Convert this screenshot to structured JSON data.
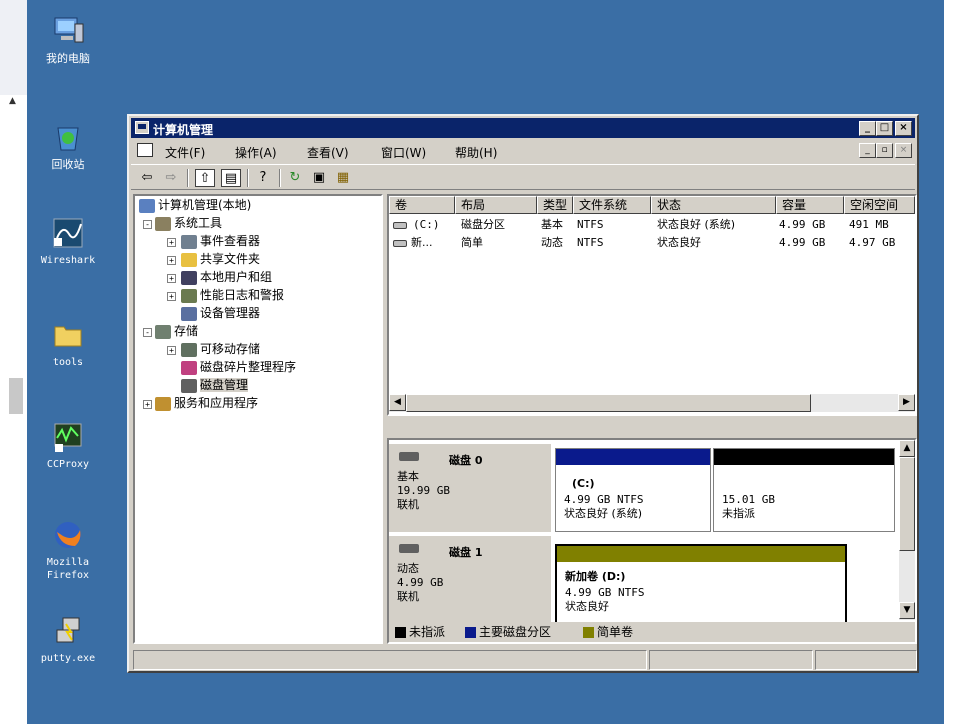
{
  "desktop": {
    "icons": [
      {
        "id": "my-computer",
        "label": "我的电脑",
        "icon": "computer-icon"
      },
      {
        "id": "recycle-bin",
        "label": "回收站",
        "icon": "recycle-bin-icon"
      },
      {
        "id": "wireshark",
        "label": "Wireshark",
        "icon": "wireshark-icon"
      },
      {
        "id": "tools",
        "label": "tools",
        "icon": "folder-icon"
      },
      {
        "id": "ccproxy",
        "label": "CCProxy",
        "icon": "ccproxy-icon"
      },
      {
        "id": "firefox",
        "label": "Mozilla Firefox",
        "label_line1": "Mozilla",
        "label_line2": "Firefox",
        "icon": "firefox-icon"
      },
      {
        "id": "putty",
        "label": "putty.exe",
        "icon": "putty-icon"
      }
    ]
  },
  "window": {
    "title": "计算机管理",
    "title_buttons": [
      "minimize-icon",
      "maximize-icon",
      "close-icon"
    ],
    "menu": [
      "文件(F)",
      "操作(A)",
      "查看(V)",
      "窗口(W)",
      "帮助(H)"
    ],
    "toolbar": [
      "back-arrow-icon",
      "forward-arrow-icon",
      "up-folder-icon",
      "show-hide-tree-icon",
      "help-icon",
      "refresh-icon",
      "properties-icon",
      "export-icon"
    ]
  },
  "tree": {
    "root": "计算机管理(本地)",
    "system_tools": "系统工具",
    "event_viewer": "事件查看器",
    "shared_folders": "共享文件夹",
    "local_users": "本地用户和组",
    "perf_logs": "性能日志和警报",
    "device_manager": "设备管理器",
    "storage": "存储",
    "removable": "可移动存储",
    "defrag": "磁盘碎片整理程序",
    "disk_mgmt": "磁盘管理",
    "services": "服务和应用程序"
  },
  "volume_list": {
    "columns": [
      "卷",
      "布局",
      "类型",
      "文件系统",
      "状态",
      "容量",
      "空闲空间"
    ],
    "rows": [
      {
        "vol": "(C:)",
        "layout": "磁盘分区",
        "type": "基本",
        "fs": "NTFS",
        "status": "状态良好 (系统)",
        "capacity": "4.99 GB",
        "free": "491 MB"
      },
      {
        "vol": "新...",
        "layout": "简单",
        "type": "动态",
        "fs": "NTFS",
        "status": "状态良好",
        "capacity": "4.99 GB",
        "free": "4.97 GB"
      }
    ]
  },
  "disks": [
    {
      "name": "磁盘 0",
      "kind": "基本",
      "size": "19.99 GB",
      "state": "联机",
      "volumes": [
        {
          "label": "(C:)",
          "line1": "4.99 GB NTFS",
          "line2": "状态良好 (系统)",
          "bar_color": "#0a1a8c"
        },
        {
          "label": "",
          "line1": "15.01 GB",
          "line2": "未指派",
          "bar_color": "#000000"
        }
      ]
    },
    {
      "name": "磁盘 1",
      "kind": "动态",
      "size": "4.99 GB",
      "state": "联机",
      "volumes": [
        {
          "label": "新加卷  (D:)",
          "line1": "4.99 GB NTFS",
          "line2": "状态良好",
          "bar_color": "#808000"
        }
      ]
    }
  ],
  "legend": [
    {
      "label": "未指派",
      "color": "#000000"
    },
    {
      "label": "主要磁盘分区",
      "color": "#0a1a8c"
    },
    {
      "label": "简单卷",
      "color": "#808000"
    }
  ],
  "colors": {
    "desktop": "#3a6ea5",
    "titlebar": "#0a246a",
    "face": "#d4d0c8"
  }
}
